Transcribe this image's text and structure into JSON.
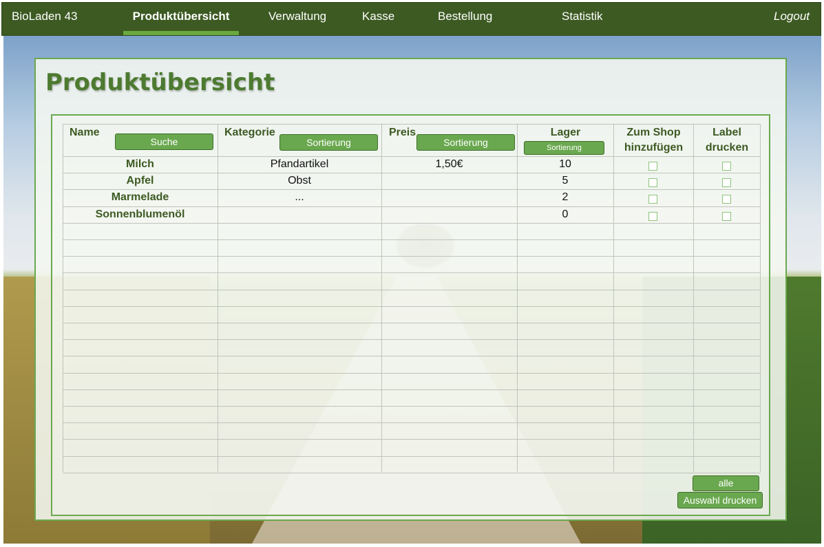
{
  "app": {
    "brand": "BioLaden 43"
  },
  "nav": {
    "items": [
      "Produktübersicht",
      "Verwaltung",
      "Kasse",
      "Bestellung",
      "Statistik"
    ],
    "active": "Produktübersicht",
    "logout": "Logout"
  },
  "page": {
    "title": "Produktübersicht"
  },
  "table": {
    "headers": {
      "name": "Name",
      "kategorie": "Kategorie",
      "preis": "Preis",
      "lager": "Lager",
      "shop_line1": "Zum Shop",
      "shop_line2": "hinzufügen",
      "label_line1": "Label",
      "label_line2": "drucken"
    },
    "header_buttons": {
      "suche": "Suche",
      "kategorie_sort": "Sortierung",
      "preis_sort": "Sortierung",
      "lager_sort": "Sortierung"
    },
    "rows": [
      {
        "name": "Milch",
        "kategorie": "Pfandartikel",
        "preis": "1,50€",
        "lager": "10",
        "zum_shop": false,
        "label": false
      },
      {
        "name": "Apfel",
        "kategorie": "Obst",
        "preis": "",
        "lager": "5",
        "zum_shop": false,
        "label": false
      },
      {
        "name": "Marmelade",
        "kategorie": "...",
        "preis": "",
        "lager": "2",
        "zum_shop": false,
        "label": false
      },
      {
        "name": "Sonnenblumenöl",
        "kategorie": "",
        "preis": "",
        "lager": "0",
        "zum_shop": false,
        "label": false
      }
    ],
    "empty_rows": 15
  },
  "actions": {
    "select_all": "alle",
    "print_selection": "Auswahl drucken"
  },
  "colors": {
    "nav_bg": "#3c5a22",
    "accent": "#6aa84f",
    "title": "#4d7a30"
  }
}
